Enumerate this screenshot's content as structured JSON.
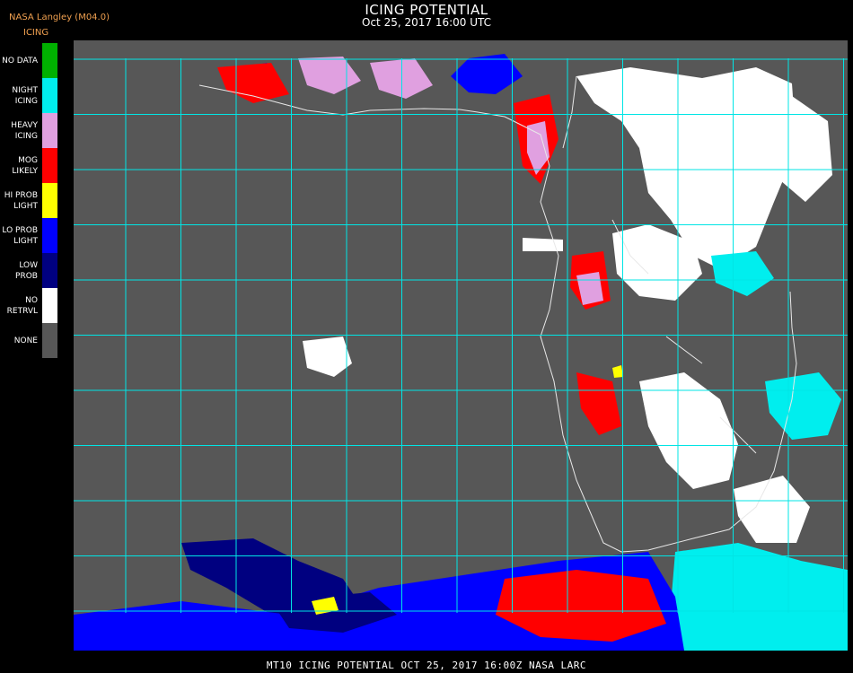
{
  "header": {
    "credit": "NASA Langley (M04.0)",
    "product": "ICING",
    "title": "ICING POTENTIAL",
    "subtitle": "Oct 25, 2017 16:00 UTC"
  },
  "legend": {
    "items": [
      {
        "label": "NO DATA",
        "color": "#00b000"
      },
      {
        "label": "NIGHT\nICING",
        "color": "#00eeee"
      },
      {
        "label": "HEAVY\nICING",
        "color": "#e0a0e0"
      },
      {
        "label": "MOG\nLIKELY",
        "color": "#ff0000"
      },
      {
        "label": "HI PROB\nLIGHT",
        "color": "#ffff00"
      },
      {
        "label": "LO PROB\nLIGHT",
        "color": "#0000ff"
      },
      {
        "label": "LOW\nPROB",
        "color": "#000080"
      },
      {
        "label": "NO\nRETRVL",
        "color": "#ffffff"
      },
      {
        "label": "NONE",
        "color": "#575757"
      }
    ]
  },
  "map": {
    "background": "#575757",
    "grid_color": "#00e5e5",
    "coast_color": "#e8e8e8"
  },
  "footer": {
    "caption": "MT10  ICING POTENTIAL   OCT 25, 2017 16:00Z   NASA LARC"
  }
}
